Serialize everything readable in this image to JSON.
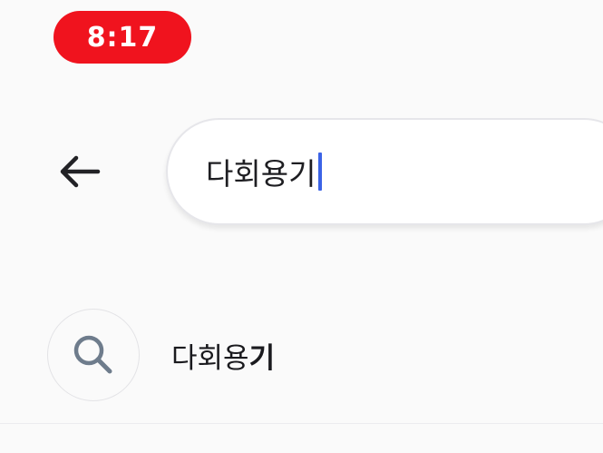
{
  "status_bar": {
    "time": "8:17",
    "time_badge_color": "#f0131e"
  },
  "header": {
    "back_icon": "arrow-left-icon",
    "search": {
      "value": "다회용기",
      "caret_color": "#3b63e6"
    }
  },
  "suggestions": [
    {
      "icon": "search-icon",
      "label_prefix": "다회용",
      "label_highlight": "기"
    }
  ]
}
